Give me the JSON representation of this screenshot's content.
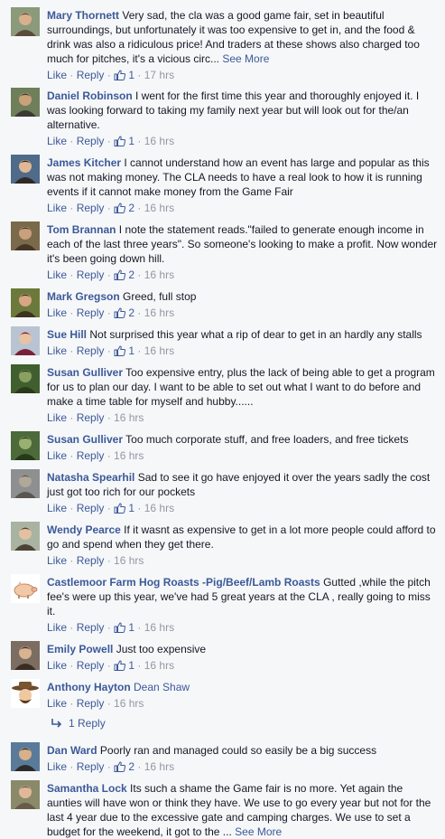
{
  "actions": {
    "like": "Like",
    "reply": "Reply",
    "sep": "·",
    "see_more": "See More"
  },
  "colors": {
    "link": "#3b5998",
    "text": "#141823",
    "muted": "#9197a3",
    "background": "#f6f7f9"
  },
  "comments": [
    {
      "name": "Mary Thornett",
      "text": "Very sad, the cla was a good game fair, set in beautiful surroundings, but unfortunately it was too expensive to get in, and the food & drink was also a ridiculous price! And traders at these shows also charged too much for pitches, it's a vicious circ...",
      "see_more": true,
      "likes": "1",
      "time": "17 hrs",
      "avatar": "profile-photo"
    },
    {
      "name": "Daniel Robinson",
      "text": "I went for the first time this year and thoroughly enjoyed it. I was looking forward to taking my family next year but will look out for the/an alternative.",
      "see_more": false,
      "likes": "1",
      "time": "16 hrs",
      "avatar": "profile-photo"
    },
    {
      "name": "James Kitcher",
      "text": "I cannot understand how an event has large and popular as this was not making money. The CLA needs to have a real look to how it is running events if it cannot make money from the Game Fair",
      "see_more": false,
      "likes": "2",
      "time": "16 hrs",
      "avatar": "profile-photo"
    },
    {
      "name": "Tom Brannan",
      "text": "I note the statement reads.\"failed to generate enough income in each of the last three years\". So someone's looking to make a profit. Now wonder it's been going down hill.",
      "see_more": false,
      "likes": "2",
      "time": "16 hrs",
      "avatar": "profile-photo"
    },
    {
      "name": "Mark Gregson",
      "text": "Greed, full stop",
      "see_more": false,
      "likes": "2",
      "time": "16 hrs",
      "avatar": "profile-photo"
    },
    {
      "name": "Sue Hill",
      "text": "Not surprised this year what a rip of dear to get in an hardly any stalls",
      "see_more": false,
      "likes": "1",
      "time": "16 hrs",
      "avatar": "profile-photo"
    },
    {
      "name": "Susan Gulliver",
      "text": "Too expensive entry, plus the lack of being able to get a program for us to plan our day. I want to be able to set out what I want to do before and make a time table for myself and hubby......",
      "see_more": false,
      "likes": "",
      "time": "16 hrs",
      "avatar": "profile-photo"
    },
    {
      "name": "Susan Gulliver",
      "text": "Too much corporate stuff, and free loaders, and free tickets",
      "see_more": false,
      "likes": "",
      "time": "16 hrs",
      "avatar": "profile-photo"
    },
    {
      "name": "Natasha Spearhil",
      "text": "Sad to see it go have enjoyed it over the years sadly the cost just got too rich for our pockets",
      "see_more": false,
      "likes": "1",
      "time": "16 hrs",
      "avatar": "profile-photo"
    },
    {
      "name": "Wendy Pearce",
      "text": "If it wasnt as expensive to get in a lot more people could afford to go and spend when they get there.",
      "see_more": false,
      "likes": "",
      "time": "16 hrs",
      "avatar": "profile-photo"
    },
    {
      "name": "Castlemoor Farm Hog Roasts -Pig/Beef/Lamb Roasts",
      "text": "Gutted ,while the pitch fee's were up this year, we've had 5 great years at the CLA , really going to miss it.",
      "see_more": false,
      "likes": "1",
      "time": "16 hrs",
      "avatar": "pig-logo"
    },
    {
      "name": "Emily Powell",
      "text": "Just too expensive",
      "see_more": false,
      "likes": "1",
      "time": "16 hrs",
      "avatar": "profile-photo"
    },
    {
      "name": "Anthony Hayton",
      "text": "Dean Shaw",
      "text_is_tag": true,
      "see_more": false,
      "likes": "",
      "time": "16 hrs",
      "avatar": "cartoon-hat"
    },
    {
      "name": "Dan Ward",
      "text": "Poorly ran and managed could so easily be a big success",
      "see_more": false,
      "likes": "2",
      "time": "16 hrs",
      "avatar": "profile-photo"
    },
    {
      "name": "Samantha Lock",
      "text": "Its such a shame the Game fair is no more. Yet again the aunties will have won or think they have. We use to go every year but not for the last 4 year due to the excessive gate and camping charges. We use to set a budget for the weekend, it got to the ...",
      "see_more": true,
      "likes": "",
      "time": "",
      "avatar": "profile-photo",
      "no_meta": true
    }
  ],
  "replies_after": {
    "index": 12,
    "label": "1 Reply",
    "icon": "reply-arrow-icon"
  }
}
